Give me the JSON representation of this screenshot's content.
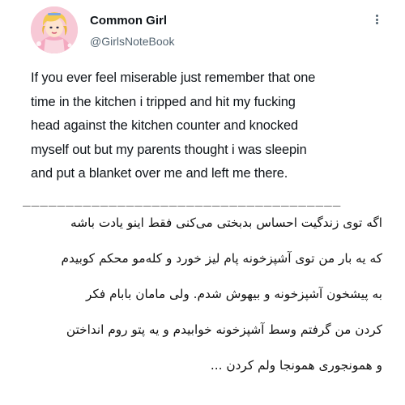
{
  "tweet": {
    "author_name": "Common Girl",
    "author_handle": "@GirlsNoteBook",
    "more_icon": "more-dots-icon",
    "body_lines": [
      "If you ever feel miserable just remember that one",
      "time in the kitchen i tripped and hit my fucking",
      "head against the kitchen counter and knocked",
      "myself out but my parents thought i was sleepin",
      "and put a blanket over me and left me there."
    ]
  },
  "separator": "_____________________________________",
  "translation": {
    "lines": [
      "اگه توی زندگیت احساس بدبختی می‌کنی فقط اینو یادت باشه",
      "که یه بار من توی آشپزخونه پام لیز خورد و کله‌مو محکم کوبیدم",
      "به پیشخون آشپزخونه و بیهوش شدم. ولی مامان بابام فکر",
      "کردن من گرفتم وسط آشپزخونه خوابیدم و یه پتو روم انداختن",
      "و همونجوری همونجا ولم کردن ..."
    ]
  },
  "colors": {
    "text": "#0f1419",
    "handle": "#536471",
    "background": "#ffffff",
    "avatar_bg": "#f4c6d3"
  }
}
